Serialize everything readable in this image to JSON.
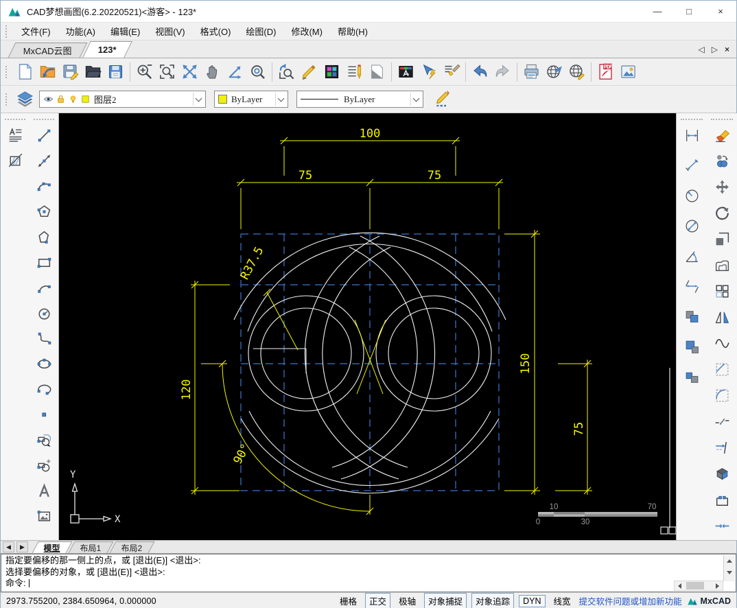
{
  "window": {
    "title": "CAD梦想画图(6.2.20220521)<游客> - 123*",
    "controls": [
      {
        "name": "minimize-button",
        "glyph": "—"
      },
      {
        "name": "maximize-button",
        "glyph": "□"
      },
      {
        "name": "close-button",
        "glyph": "×"
      }
    ]
  },
  "menu_bar": {
    "items": [
      "文件(F)",
      "功能(A)",
      "编辑(E)",
      "视图(V)",
      "格式(O)",
      "绘图(D)",
      "修改(M)",
      "帮助(H)"
    ]
  },
  "tab_bar": {
    "tabs": [
      {
        "label": "MxCAD云图",
        "active": false
      },
      {
        "label": "123*",
        "active": true
      }
    ],
    "nav_prev": "◁",
    "nav_next": "▷",
    "nav_close": "×"
  },
  "toolbar_main": {
    "icons": [
      {
        "name": "new-file-icon",
        "sprite": "s-new"
      },
      {
        "name": "open-drawing-icon",
        "sprite": "s-opendwg"
      },
      {
        "name": "save-icon",
        "sprite": "s-save"
      },
      {
        "name": "open-folder-icon",
        "sprite": "s-openfolder"
      },
      {
        "name": "save-as-icon",
        "sprite": "s-saveas"
      },
      {
        "separator": true
      },
      {
        "name": "zoom-in-out-icon",
        "sprite": "s-zoompm"
      },
      {
        "name": "zoom-window-icon",
        "sprite": "s-zoomwin"
      },
      {
        "name": "zoom-extents-icon",
        "sprite": "s-zoomext"
      },
      {
        "name": "pan-icon",
        "sprite": "s-pan"
      },
      {
        "name": "view-axes-icon",
        "sprite": "s-axes"
      },
      {
        "name": "zoom-center-icon",
        "sprite": "s-zoomcenter"
      },
      {
        "separator": true
      },
      {
        "name": "zoom-previous-icon",
        "sprite": "s-zoomprev"
      },
      {
        "name": "sketch-pencil-icon",
        "sprite": "s-sketch"
      },
      {
        "name": "color-palette-icon",
        "sprite": "s-palette"
      },
      {
        "name": "linetype-manager-icon",
        "sprite": "s-linetype"
      },
      {
        "name": "lineweight-icon",
        "sprite": "s-lineweight"
      },
      {
        "separator": true
      },
      {
        "name": "text-style-icon",
        "sprite": "s-textstyle"
      },
      {
        "name": "quick-select-icon",
        "sprite": "s-quickselect"
      },
      {
        "name": "match-properties-icon",
        "sprite": "s-matchprops"
      },
      {
        "separator": true
      },
      {
        "name": "undo-icon",
        "sprite": "s-undo"
      },
      {
        "name": "redo-icon",
        "sprite": "s-redo"
      },
      {
        "separator": true
      },
      {
        "name": "print-icon",
        "sprite": "s-print"
      },
      {
        "name": "web-publish-icon",
        "sprite": "s-webpub"
      },
      {
        "name": "web-globe-icon",
        "sprite": "s-webglobe"
      },
      {
        "separator": true
      },
      {
        "name": "pdf-export-icon",
        "sprite": "s-pdf"
      },
      {
        "name": "insert-image-icon",
        "sprite": "s-image"
      }
    ]
  },
  "layer_bar": {
    "layers_button": {
      "name": "layers-icon",
      "sprite": "s-layers"
    },
    "layer_combo": {
      "value": "图层2",
      "icons": [
        {
          "name": "visibility-eye-icon",
          "sprite": "s-eye"
        },
        {
          "name": "lock-icon",
          "sprite": "s-lock"
        },
        {
          "name": "bulb-icon",
          "sprite": "s-bulb"
        },
        {
          "name": "layer-color-icon",
          "sprite": "s-colorsq"
        }
      ]
    },
    "color_combo": {
      "value": "ByLayer"
    },
    "linetype_combo": {
      "value": "ByLayer"
    },
    "edit_button": {
      "name": "draw-pencil-icon",
      "sprite": "s-pencilbig"
    }
  },
  "left_toolbar": {
    "format_icons": [
      {
        "name": "text-format-icon",
        "sprite": "s-textlines"
      },
      {
        "name": "hatch-icon",
        "sprite": "s-hatch"
      }
    ],
    "draw_icons": [
      {
        "name": "line-icon",
        "sprite": "s-line"
      },
      {
        "name": "construction-line-icon",
        "sprite": "s-xline"
      },
      {
        "name": "arc-icon",
        "sprite": "s-arc"
      },
      {
        "name": "polygon-icon",
        "sprite": "s-pgon"
      },
      {
        "name": "polyline-icon",
        "sprite": "s-poly"
      },
      {
        "name": "rectangle-icon",
        "sprite": "s-rect"
      },
      {
        "name": "arc-3point-icon",
        "sprite": "s-arc3"
      },
      {
        "name": "circle-icon",
        "sprite": "s-circle"
      },
      {
        "name": "spline-icon",
        "sprite": "s-spline"
      },
      {
        "name": "ellipse-icon",
        "sprite": "s-ellipse"
      },
      {
        "name": "ellipse-arc-icon",
        "sprite": "s-earc"
      },
      {
        "name": "point-icon",
        "sprite": "s-point"
      },
      {
        "name": "copy-object-icon",
        "sprite": "s-copyobj"
      },
      {
        "name": "block-insert-icon",
        "sprite": "s-blockins"
      },
      {
        "name": "text-icon",
        "sprite": "s-textA"
      },
      {
        "name": "image-insert-icon",
        "sprite": "s-imageins"
      }
    ]
  },
  "right_toolbar": {
    "dimension_icons": [
      {
        "name": "dim-linear-icon",
        "sprite": "s-dimlin"
      },
      {
        "name": "dim-aligned-icon",
        "sprite": "s-dimalign"
      },
      {
        "name": "dim-radius-icon",
        "sprite": "s-dimrad"
      },
      {
        "name": "dim-diameter-icon",
        "sprite": "s-dimdia"
      },
      {
        "name": "dim-angular-icon",
        "sprite": "s-dimang"
      },
      {
        "name": "dim-parallel-icon",
        "sprite": "s-dimpar"
      },
      {
        "name": "dim-continue-icon",
        "sprite": "s-dimcont"
      },
      {
        "name": "dim-baseline-icon",
        "sprite": "s-dimbase"
      },
      {
        "name": "dim-quick-icon",
        "sprite": "s-dimquick"
      }
    ],
    "modify_icons": [
      {
        "name": "erase-icon",
        "sprite": "s-erase"
      },
      {
        "name": "copy-icon",
        "sprite": "s-copy"
      },
      {
        "name": "move-icon",
        "sprite": "s-move"
      },
      {
        "name": "rotate-icon",
        "sprite": "s-rotate"
      },
      {
        "name": "scale-icon",
        "sprite": "s-scale"
      },
      {
        "name": "offset-icon",
        "sprite": "s-offset"
      },
      {
        "name": "array-icon",
        "sprite": "s-array"
      },
      {
        "name": "mirror-icon",
        "sprite": "s-mirror"
      },
      {
        "name": "spline-edit-icon",
        "sprite": "s-splineedit"
      },
      {
        "name": "chamfer-icon",
        "sprite": "s-chamfer"
      },
      {
        "name": "fillet-icon",
        "sprite": "s-fillet"
      },
      {
        "name": "break-icon",
        "sprite": "s-break"
      },
      {
        "name": "trim-icon",
        "sprite": "s-trim"
      },
      {
        "name": "explode-icon",
        "sprite": "s-explode"
      },
      {
        "name": "stretch-icon",
        "sprite": "s-stretch"
      },
      {
        "name": "join-icon",
        "sprite": "s-join"
      }
    ]
  },
  "canvas": {
    "colors": {
      "background": "#000000",
      "grid_blue": "#3b77cf",
      "geometry_white": "#f2f2f2",
      "dimension_yellow": "#f6f600"
    },
    "dimensions": {
      "top_width": "100",
      "left_width": "75",
      "right_width": "75",
      "left_height": "120",
      "right_height": "150",
      "right_inner_height": "75",
      "radius_label": "R37.5",
      "angle_label": "90°"
    },
    "scale_bar": {
      "top_left": "10",
      "top_right": "70",
      "bottom_left": "0",
      "bottom_right": "30"
    },
    "ucs": {
      "x_label": "X",
      "y_label": "Y"
    }
  },
  "layout_tabs": {
    "nav_prev": "◀",
    "nav_next": "▶",
    "tabs": [
      {
        "label": "模型",
        "active": true
      },
      {
        "label": "布局1",
        "active": false
      },
      {
        "label": "布局2",
        "active": false
      }
    ]
  },
  "command_panel": {
    "history": [
      "指定要偏移的那一侧上的点，或 [退出(E)] <退出>:",
      "选择要偏移的对象，或 [退出(E)] <退出>:"
    ],
    "prompt": "命令:"
  },
  "status_bar": {
    "coordinates": "2973.755200,  2384.650964,  0.000000",
    "toggles": [
      {
        "label": "栅格",
        "boxed": false
      },
      {
        "label": "正交",
        "boxed": true
      },
      {
        "label": "极轴",
        "boxed": false
      },
      {
        "label": "对象捕捉",
        "boxed": true
      },
      {
        "label": "对象追踪",
        "boxed": true
      },
      {
        "label": "DYN",
        "boxed": true
      },
      {
        "label": "线宽",
        "boxed": false
      }
    ],
    "feedback_link": "提交软件问题或增加新功能",
    "brand": "MxCAD"
  }
}
